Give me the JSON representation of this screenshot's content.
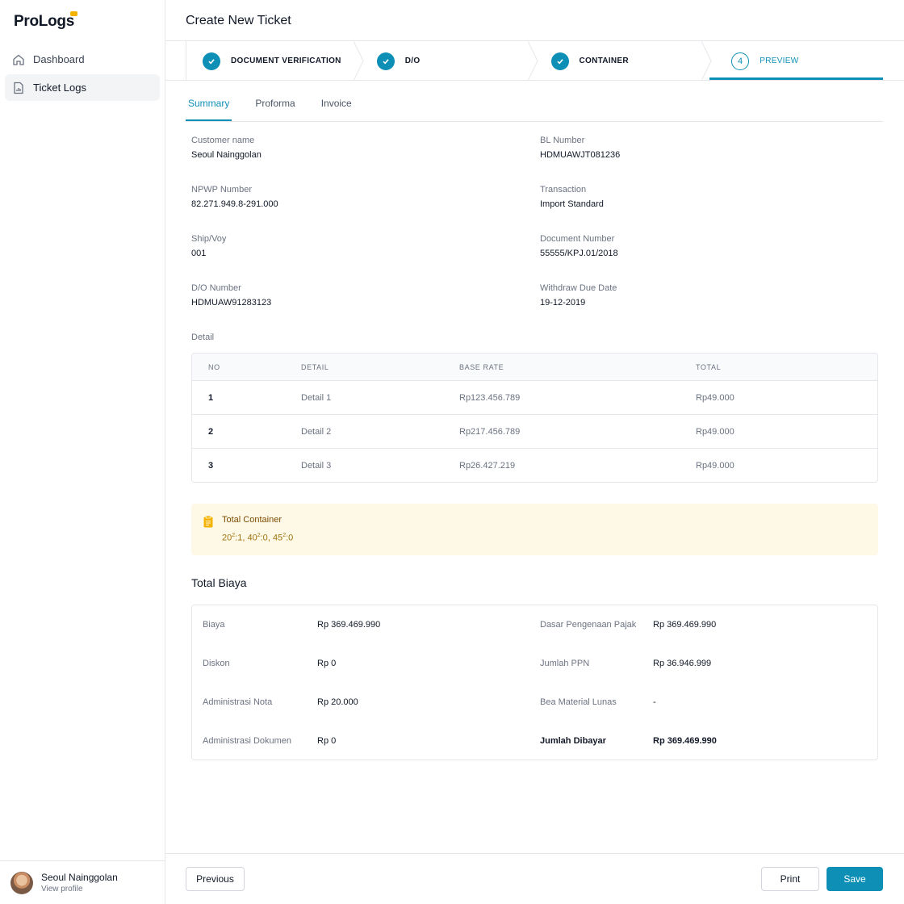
{
  "app": {
    "logo_text": "ProLogs",
    "nav": [
      {
        "label": "Dashboard",
        "icon": "home-icon"
      },
      {
        "label": "Ticket Logs",
        "icon": "document-chart-icon"
      }
    ],
    "profile": {
      "name": "Seoul Nainggolan",
      "link": "View profile"
    }
  },
  "header": {
    "title": "Create New Ticket"
  },
  "steps": [
    {
      "label": "DOCUMENT VERIFICATION",
      "status": "done"
    },
    {
      "label": "D/O",
      "status": "done"
    },
    {
      "label": "CONTAINER",
      "status": "done"
    },
    {
      "label": "PREVIEW",
      "number": "4",
      "status": "current"
    }
  ],
  "tabs": [
    "Summary",
    "Proforma",
    "Invoice"
  ],
  "summary": {
    "customer_label": "Customer name",
    "customer_value": "Seoul Nainggolan",
    "bl_label": "BL Number",
    "bl_value": "HDMUAWJT081236",
    "npwp_label": "NPWP Number",
    "npwp_value": "82.271.949.8-291.000",
    "transaction_label": "Transaction",
    "transaction_value": "Import Standard",
    "shipvoy_label": "Ship/Voy",
    "shipvoy_value": "001",
    "docnum_label": "Document Number",
    "docnum_value": "55555/KPJ.01/2018",
    "do_label": "D/O Number",
    "do_value": "HDMUAW91283123",
    "due_label": "Withdraw Due Date",
    "due_value": "19-12-2019"
  },
  "detail": {
    "title": "Detail",
    "columns": [
      "NO",
      "DETAIL",
      "BASE RATE",
      "TOTAL"
    ],
    "rows": [
      [
        "1",
        "Detail 1",
        "Rp123.456.789",
        "Rp49.000"
      ],
      [
        "2",
        "Detail 2",
        "Rp217.456.789",
        "Rp49.000"
      ],
      [
        "3",
        "Detail 3",
        "Rp26.427.219",
        "Rp49.000"
      ]
    ]
  },
  "container_alert": {
    "title": "Total Container",
    "items": [
      {
        "size": "20",
        "sup": "2",
        "count": ":1"
      },
      {
        "size": "40",
        "sup": "2",
        "count": ":0"
      },
      {
        "size": "45",
        "sup": "2",
        "count": ":0"
      }
    ]
  },
  "total_biaya": {
    "title": "Total Biaya",
    "left": [
      {
        "label": "Biaya",
        "value": "Rp 369.469.990"
      },
      {
        "label": "Diskon",
        "value": "Rp 0"
      },
      {
        "label": "Administrasi Nota",
        "value": "Rp 20.000"
      },
      {
        "label": "Administrasi Dokumen",
        "value": "Rp 0"
      }
    ],
    "right": [
      {
        "label": "Dasar Pengenaan Pajak",
        "value": "Rp 369.469.990"
      },
      {
        "label": "Jumlah PPN",
        "value": "Rp 36.946.999"
      },
      {
        "label": "Bea Material Lunas",
        "value": "-"
      },
      {
        "label": "Jumlah Dibayar",
        "value": "Rp 369.469.990"
      }
    ]
  },
  "footer": {
    "previous": "Previous",
    "print": "Print",
    "save": "Save"
  },
  "colors": {
    "accent": "#0e8fb5",
    "alert_bg": "#fef9e7",
    "alert_icon": "#f5b301"
  }
}
